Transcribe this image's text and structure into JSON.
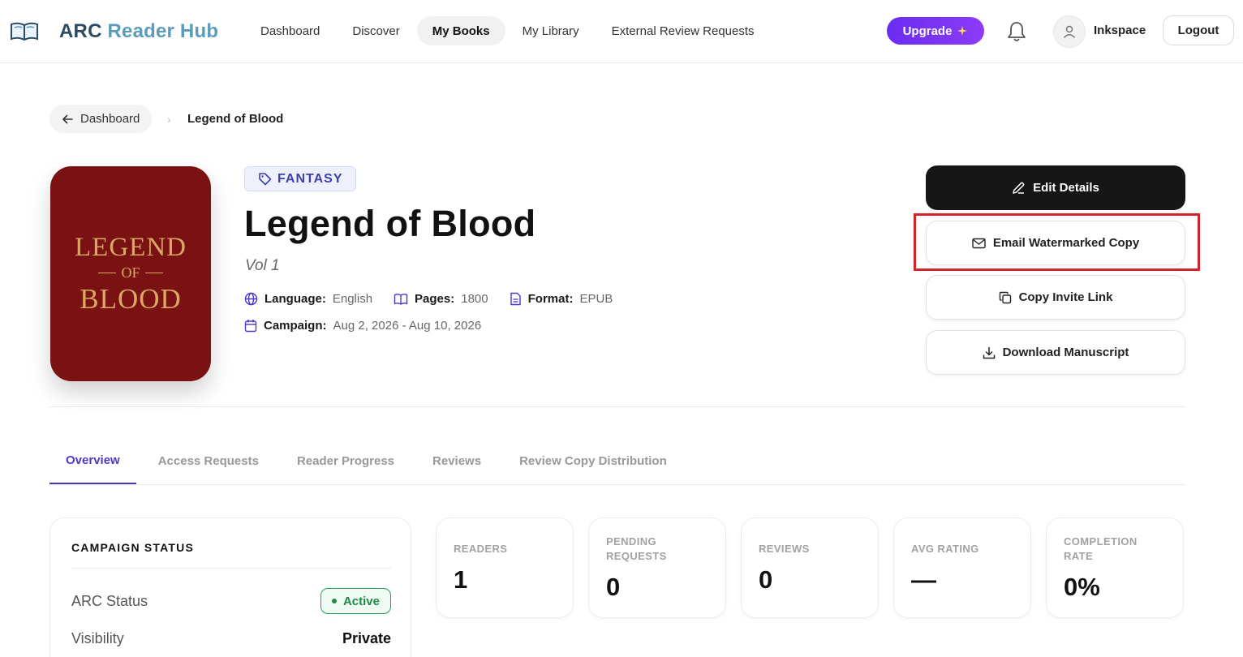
{
  "header": {
    "brand_part1": "ARC",
    "brand_part2": "Reader Hub",
    "nav": [
      {
        "label": "Dashboard",
        "active": false
      },
      {
        "label": "Discover",
        "active": false
      },
      {
        "label": "My Books",
        "active": true
      },
      {
        "label": "My Library",
        "active": false
      },
      {
        "label": "External Review Requests",
        "active": false
      }
    ],
    "upgrade_label": "Upgrade",
    "username": "Inkspace",
    "logout_label": "Logout"
  },
  "breadcrumb": {
    "back_label": "Dashboard",
    "current": "Legend of Blood"
  },
  "cover": {
    "line1": "LEGEND",
    "line2": "OF",
    "line3": "BLOOD"
  },
  "book": {
    "genre": "FANTASY",
    "title": "Legend of Blood",
    "subtitle": "Vol 1",
    "language_label": "Language:",
    "language": "English",
    "pages_label": "Pages:",
    "pages": "1800",
    "format_label": "Format:",
    "format": "EPUB",
    "campaign_label": "Campaign:",
    "campaign": "Aug 2, 2026 - Aug 10, 2026"
  },
  "actions": {
    "edit": "Edit Details",
    "email": "Email Watermarked Copy",
    "invite": "Copy Invite Link",
    "download": "Download Manuscript"
  },
  "tabs": [
    {
      "label": "Overview",
      "active": true
    },
    {
      "label": "Access Requests",
      "active": false
    },
    {
      "label": "Reader Progress",
      "active": false
    },
    {
      "label": "Reviews",
      "active": false
    },
    {
      "label": "Review Copy Distribution",
      "active": false
    }
  ],
  "campaign_status": {
    "heading": "CAMPAIGN STATUS",
    "arc_status_label": "ARC Status",
    "arc_status_value": "Active",
    "visibility_label": "Visibility",
    "visibility_value": "Private"
  },
  "stats": [
    {
      "label": "READERS",
      "value": "1"
    },
    {
      "label": "PENDING REQUESTS",
      "value": "0"
    },
    {
      "label": "REVIEWS",
      "value": "0"
    },
    {
      "label": "AVG RATING",
      "value": "—"
    },
    {
      "label": "COMPLETION RATE",
      "value": "0%"
    }
  ],
  "colors": {
    "accent": "#4b38c9",
    "upgrade": "#7b34f5",
    "cover": "#7a1113",
    "highlight": "#d4242b",
    "active_green": "#1e8a43"
  }
}
